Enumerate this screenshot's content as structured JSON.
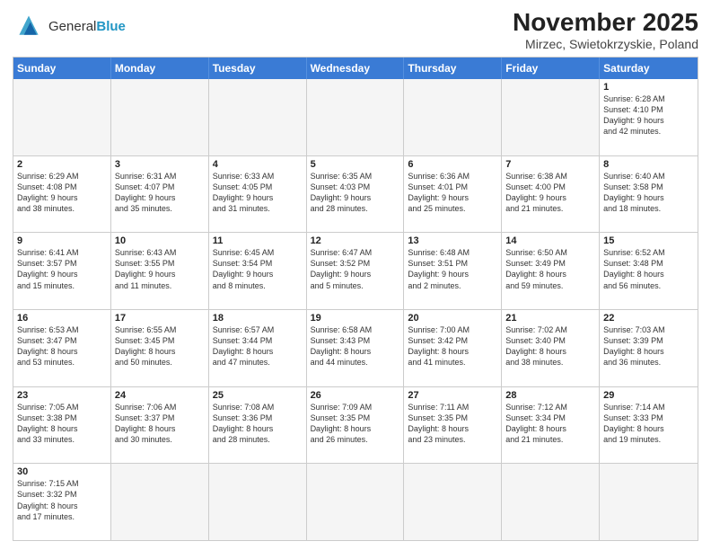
{
  "header": {
    "logo_general": "General",
    "logo_blue": "Blue",
    "title": "November 2025",
    "subtitle": "Mirzec, Swietokrzyskie, Poland"
  },
  "days_of_week": [
    "Sunday",
    "Monday",
    "Tuesday",
    "Wednesday",
    "Thursday",
    "Friday",
    "Saturday"
  ],
  "weeks": [
    [
      {
        "day": "",
        "info": ""
      },
      {
        "day": "",
        "info": ""
      },
      {
        "day": "",
        "info": ""
      },
      {
        "day": "",
        "info": ""
      },
      {
        "day": "",
        "info": ""
      },
      {
        "day": "",
        "info": ""
      },
      {
        "day": "1",
        "info": "Sunrise: 6:28 AM\nSunset: 4:10 PM\nDaylight: 9 hours\nand 42 minutes."
      }
    ],
    [
      {
        "day": "2",
        "info": "Sunrise: 6:29 AM\nSunset: 4:08 PM\nDaylight: 9 hours\nand 38 minutes."
      },
      {
        "day": "3",
        "info": "Sunrise: 6:31 AM\nSunset: 4:07 PM\nDaylight: 9 hours\nand 35 minutes."
      },
      {
        "day": "4",
        "info": "Sunrise: 6:33 AM\nSunset: 4:05 PM\nDaylight: 9 hours\nand 31 minutes."
      },
      {
        "day": "5",
        "info": "Sunrise: 6:35 AM\nSunset: 4:03 PM\nDaylight: 9 hours\nand 28 minutes."
      },
      {
        "day": "6",
        "info": "Sunrise: 6:36 AM\nSunset: 4:01 PM\nDaylight: 9 hours\nand 25 minutes."
      },
      {
        "day": "7",
        "info": "Sunrise: 6:38 AM\nSunset: 4:00 PM\nDaylight: 9 hours\nand 21 minutes."
      },
      {
        "day": "8",
        "info": "Sunrise: 6:40 AM\nSunset: 3:58 PM\nDaylight: 9 hours\nand 18 minutes."
      }
    ],
    [
      {
        "day": "9",
        "info": "Sunrise: 6:41 AM\nSunset: 3:57 PM\nDaylight: 9 hours\nand 15 minutes."
      },
      {
        "day": "10",
        "info": "Sunrise: 6:43 AM\nSunset: 3:55 PM\nDaylight: 9 hours\nand 11 minutes."
      },
      {
        "day": "11",
        "info": "Sunrise: 6:45 AM\nSunset: 3:54 PM\nDaylight: 9 hours\nand 8 minutes."
      },
      {
        "day": "12",
        "info": "Sunrise: 6:47 AM\nSunset: 3:52 PM\nDaylight: 9 hours\nand 5 minutes."
      },
      {
        "day": "13",
        "info": "Sunrise: 6:48 AM\nSunset: 3:51 PM\nDaylight: 9 hours\nand 2 minutes."
      },
      {
        "day": "14",
        "info": "Sunrise: 6:50 AM\nSunset: 3:49 PM\nDaylight: 8 hours\nand 59 minutes."
      },
      {
        "day": "15",
        "info": "Sunrise: 6:52 AM\nSunset: 3:48 PM\nDaylight: 8 hours\nand 56 minutes."
      }
    ],
    [
      {
        "day": "16",
        "info": "Sunrise: 6:53 AM\nSunset: 3:47 PM\nDaylight: 8 hours\nand 53 minutes."
      },
      {
        "day": "17",
        "info": "Sunrise: 6:55 AM\nSunset: 3:45 PM\nDaylight: 8 hours\nand 50 minutes."
      },
      {
        "day": "18",
        "info": "Sunrise: 6:57 AM\nSunset: 3:44 PM\nDaylight: 8 hours\nand 47 minutes."
      },
      {
        "day": "19",
        "info": "Sunrise: 6:58 AM\nSunset: 3:43 PM\nDaylight: 8 hours\nand 44 minutes."
      },
      {
        "day": "20",
        "info": "Sunrise: 7:00 AM\nSunset: 3:42 PM\nDaylight: 8 hours\nand 41 minutes."
      },
      {
        "day": "21",
        "info": "Sunrise: 7:02 AM\nSunset: 3:40 PM\nDaylight: 8 hours\nand 38 minutes."
      },
      {
        "day": "22",
        "info": "Sunrise: 7:03 AM\nSunset: 3:39 PM\nDaylight: 8 hours\nand 36 minutes."
      }
    ],
    [
      {
        "day": "23",
        "info": "Sunrise: 7:05 AM\nSunset: 3:38 PM\nDaylight: 8 hours\nand 33 minutes."
      },
      {
        "day": "24",
        "info": "Sunrise: 7:06 AM\nSunset: 3:37 PM\nDaylight: 8 hours\nand 30 minutes."
      },
      {
        "day": "25",
        "info": "Sunrise: 7:08 AM\nSunset: 3:36 PM\nDaylight: 8 hours\nand 28 minutes."
      },
      {
        "day": "26",
        "info": "Sunrise: 7:09 AM\nSunset: 3:35 PM\nDaylight: 8 hours\nand 26 minutes."
      },
      {
        "day": "27",
        "info": "Sunrise: 7:11 AM\nSunset: 3:35 PM\nDaylight: 8 hours\nand 23 minutes."
      },
      {
        "day": "28",
        "info": "Sunrise: 7:12 AM\nSunset: 3:34 PM\nDaylight: 8 hours\nand 21 minutes."
      },
      {
        "day": "29",
        "info": "Sunrise: 7:14 AM\nSunset: 3:33 PM\nDaylight: 8 hours\nand 19 minutes."
      }
    ],
    [
      {
        "day": "30",
        "info": "Sunrise: 7:15 AM\nSunset: 3:32 PM\nDaylight: 8 hours\nand 17 minutes."
      },
      {
        "day": "",
        "info": ""
      },
      {
        "day": "",
        "info": ""
      },
      {
        "day": "",
        "info": ""
      },
      {
        "day": "",
        "info": ""
      },
      {
        "day": "",
        "info": ""
      },
      {
        "day": "",
        "info": ""
      }
    ]
  ]
}
